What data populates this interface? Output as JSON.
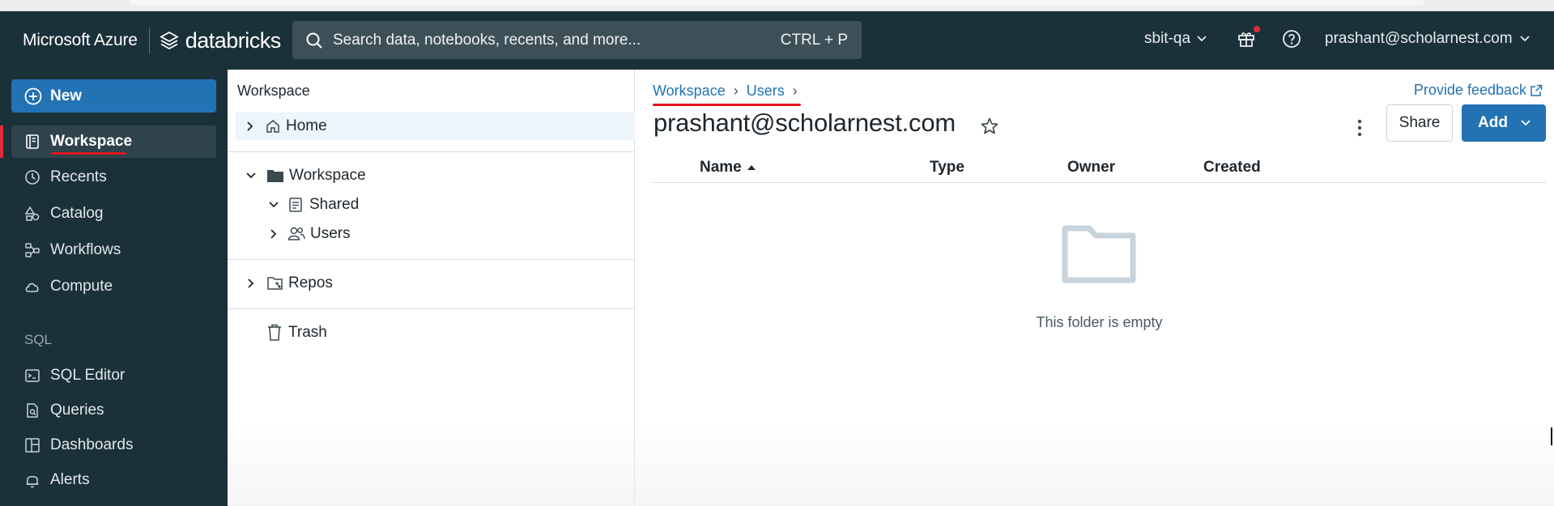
{
  "brand": {
    "microsoft": "Microsoft Azure",
    "product": "databricks"
  },
  "search": {
    "placeholder": "Search data, notebooks, recents, and more...",
    "shortcut": "CTRL + P"
  },
  "topbar": {
    "workspace": "sbit-qa",
    "user": "prashant@scholarnest.com"
  },
  "sidebar": {
    "new_label": "New",
    "items": [
      {
        "label": "Workspace",
        "icon": "workspace-icon",
        "active": true
      },
      {
        "label": "Recents",
        "icon": "clock-icon"
      },
      {
        "label": "Catalog",
        "icon": "catalog-icon"
      },
      {
        "label": "Workflows",
        "icon": "workflows-icon"
      },
      {
        "label": "Compute",
        "icon": "cloud-icon"
      }
    ],
    "sql_section": "SQL",
    "sql_items": [
      {
        "label": "SQL Editor",
        "icon": "sql-editor-icon"
      },
      {
        "label": "Queries",
        "icon": "queries-icon"
      },
      {
        "label": "Dashboards",
        "icon": "dashboards-icon"
      },
      {
        "label": "Alerts",
        "icon": "bell-icon"
      }
    ]
  },
  "tree": {
    "title": "Workspace",
    "home": "Home",
    "workspace": "Workspace",
    "shared": "Shared",
    "users": "Users",
    "repos": "Repos",
    "trash": "Trash"
  },
  "main": {
    "breadcrumb": [
      "Workspace",
      "Users"
    ],
    "feedback": "Provide feedback",
    "title": "prashant@scholarnest.com",
    "share_label": "Share",
    "add_label": "Add",
    "columns": [
      "Name",
      "Type",
      "Owner",
      "Created"
    ],
    "empty_message": "This folder is empty"
  },
  "colors": {
    "sidebar_bg": "#1b3139",
    "accent_blue": "#2272b4",
    "annotation_red": "#e0151f"
  }
}
